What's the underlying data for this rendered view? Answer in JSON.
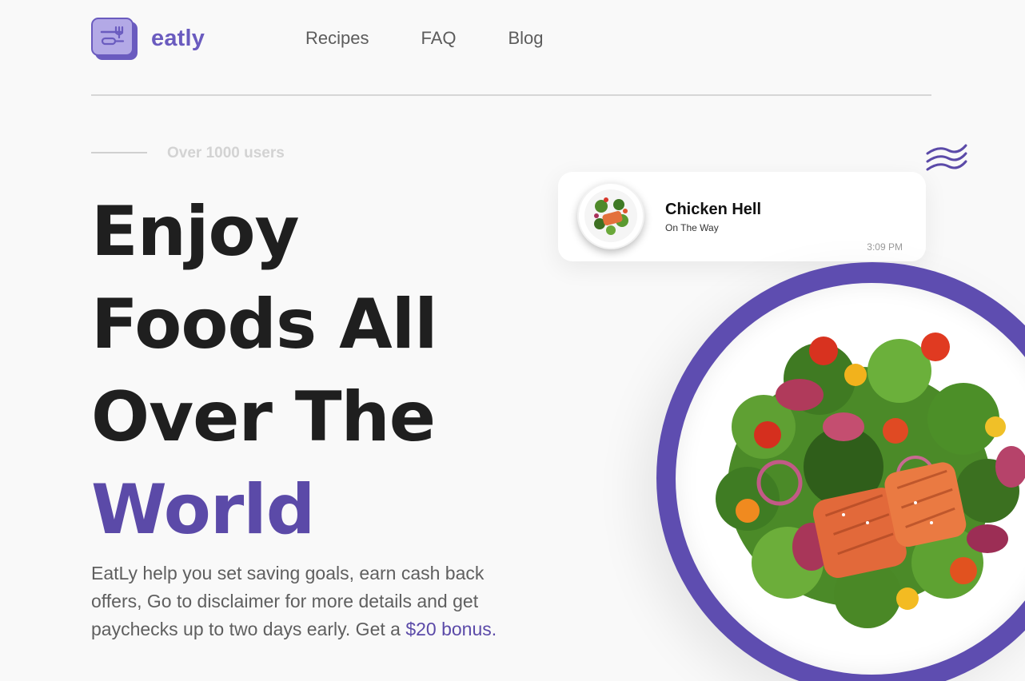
{
  "brand": {
    "name": "eatly"
  },
  "nav": {
    "items": [
      "Recipes",
      "FAQ",
      "Blog"
    ]
  },
  "hero": {
    "users_label": "Over 1000 users",
    "title_lines": [
      "Enjoy",
      "Foods All",
      "Over The"
    ],
    "title_accent": "World",
    "description": "EatLy help you set saving goals, earn cash back offers, Go to disclaimer for more details and get paychecks up to two days early. Get a ",
    "bonus_text": "$20 bonus."
  },
  "order_card": {
    "title": "Chicken Hell",
    "status": "On The Way",
    "time": "3:09 PM"
  },
  "colors": {
    "accent": "#5b4aa8",
    "logo": "#6a5bbf",
    "plate_ring": "#5e4db0",
    "background": "#f9f9f9"
  },
  "icons": [
    "logo-cutlery-icon",
    "waves-decoration-icon",
    "salmon-salad-image",
    "salad-thumbnail-image"
  ]
}
